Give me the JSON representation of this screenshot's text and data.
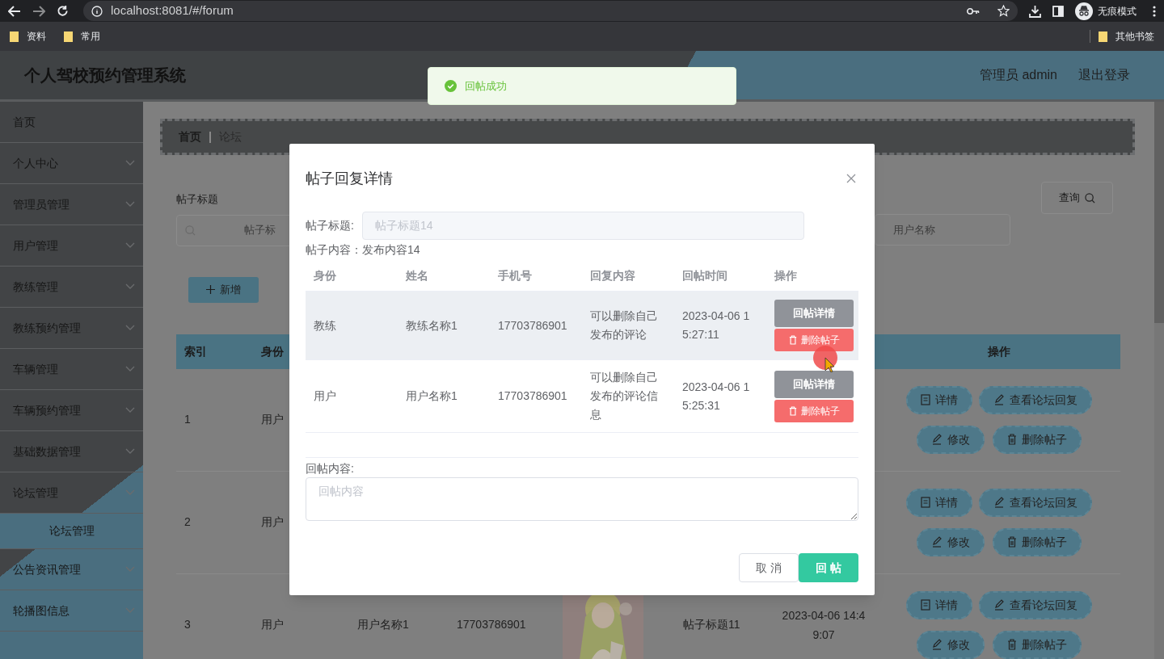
{
  "browser": {
    "url": "localhost:8081/#/forum",
    "profile": "无痕模式",
    "bookmarks": [
      "资料",
      "常用"
    ],
    "other_bookmarks": "其他书签"
  },
  "header": {
    "title": "个人驾校预约管理系统",
    "user": "管理员 admin",
    "logout": "退出登录"
  },
  "toast": {
    "kind": "success",
    "message": "回帖成功"
  },
  "sidebar": {
    "items": [
      {
        "label": "首页",
        "kind": "link"
      },
      {
        "label": "个人中心",
        "kind": "submenu"
      },
      {
        "label": "管理员管理",
        "kind": "submenu"
      },
      {
        "label": "用户管理",
        "kind": "submenu"
      },
      {
        "label": "教练管理",
        "kind": "submenu"
      },
      {
        "label": "教练预约管理",
        "kind": "submenu"
      },
      {
        "label": "车辆管理",
        "kind": "submenu"
      },
      {
        "label": "车辆预约管理",
        "kind": "submenu"
      },
      {
        "label": "基础数据管理",
        "kind": "submenu"
      },
      {
        "label": "论坛管理",
        "kind": "submenu",
        "children": [
          {
            "label": "论坛管理",
            "selected": true
          }
        ]
      },
      {
        "label": "公告资讯管理",
        "kind": "submenu"
      },
      {
        "label": "轮播图信息",
        "kind": "submenu"
      }
    ]
  },
  "breadcrumb": [
    "首页",
    "论坛"
  ],
  "search": {
    "title_label": "帖子标题",
    "title_placeholder": "帖子标",
    "user_placeholder": "用户名称",
    "query_button": "查询"
  },
  "add_button": "新增",
  "table": {
    "columns": [
      "索引",
      "身份"
    ],
    "action_column": "操作",
    "rows": [
      {
        "index": "1",
        "role": "用户",
        "actions": [
          "详情",
          "查看论坛回复",
          "修改",
          "删除帖子"
        ]
      },
      {
        "index": "2",
        "role": "用户",
        "actions": [
          "详情",
          "查看论坛回复",
          "修改",
          "删除帖子"
        ]
      },
      {
        "index": "3",
        "role": "用户",
        "name": "用户名称1",
        "phone": "17703786901",
        "title": "帖子标题11",
        "time": "2023-04-06 14:49:07",
        "actions": [
          "详情",
          "查看论坛回复",
          "修改",
          "删除帖子"
        ]
      }
    ]
  },
  "dialog": {
    "title": "帖子回复详情",
    "title_label": "帖子标题:",
    "title_value": "帖子标题14",
    "content_text": "帖子内容：发布内容14",
    "columns": [
      "身份",
      "姓名",
      "手机号",
      "回复内容",
      "回帖时间",
      "操作"
    ],
    "rows": [
      {
        "role": "教练",
        "name": "教练名称1",
        "phone": "17703786901",
        "content": "可以删除自己发布的评论",
        "time": "2023-04-06 15:27:11",
        "highlighted": true,
        "actions": [
          {
            "label": "回帖详情",
            "kind": "detail"
          },
          {
            "label": "删除帖子",
            "kind": "delete"
          }
        ]
      },
      {
        "role": "用户",
        "name": "用户名称1",
        "phone": "17703786901",
        "content": "可以删除自己发布的评论信息",
        "time": "2023-04-06 15:25:31",
        "highlighted": false,
        "actions": [
          {
            "label": "回帖详情",
            "kind": "detail"
          },
          {
            "label": "删除帖子",
            "kind": "delete"
          }
        ]
      }
    ],
    "reply_label": "回帖内容:",
    "reply_placeholder": "回帖内容",
    "cancel_button": "取 消",
    "submit_button": "回 帖"
  }
}
